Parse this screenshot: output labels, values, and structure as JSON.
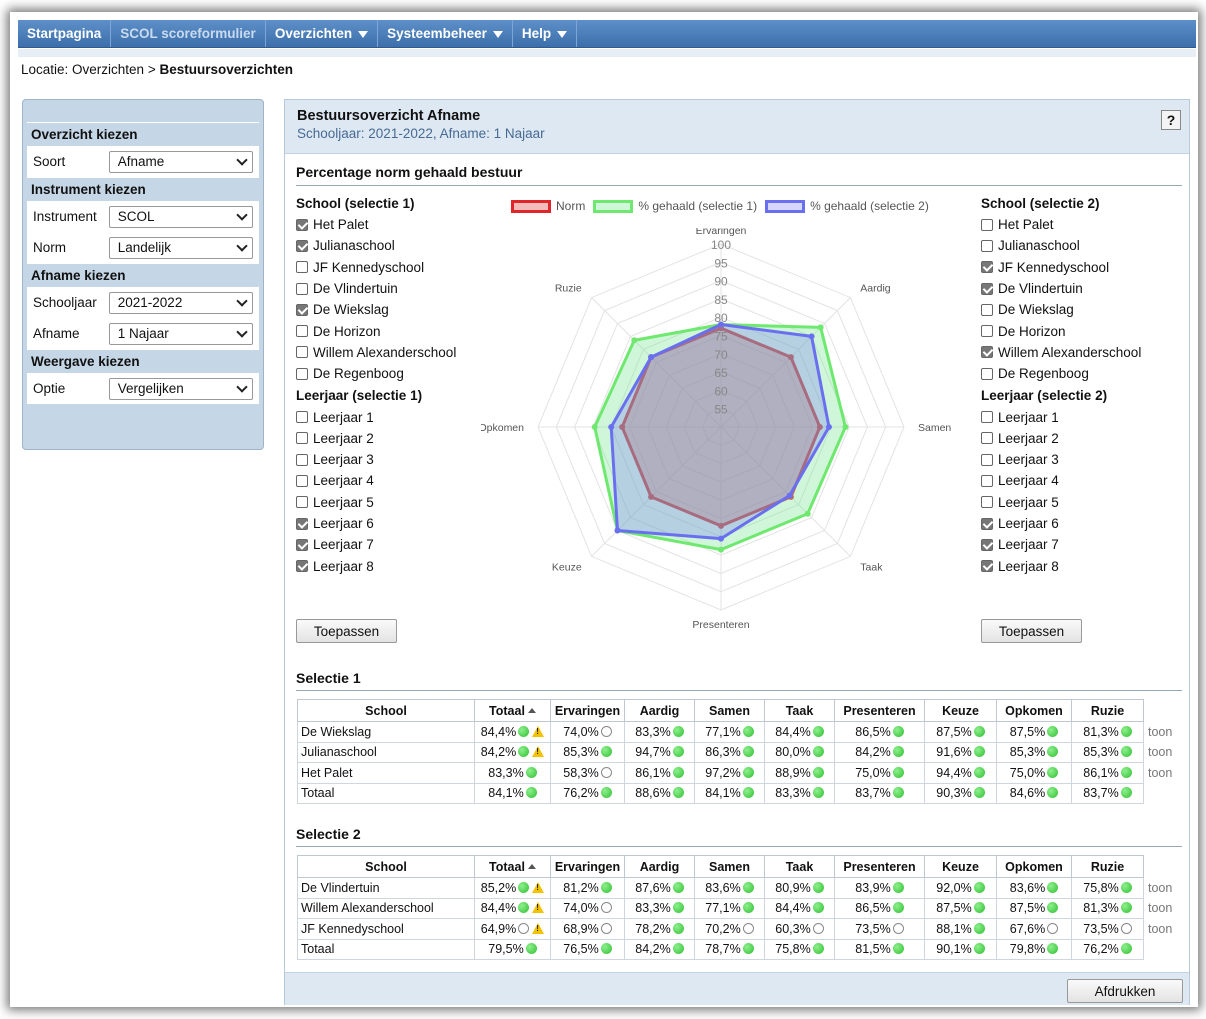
{
  "nav": {
    "items": [
      {
        "label": "Startpagina",
        "dropdown": false,
        "active": false
      },
      {
        "label": "SCOL scoreformulier",
        "dropdown": false,
        "active": true
      },
      {
        "label": "Overzichten",
        "dropdown": true,
        "active": false
      },
      {
        "label": "Systeembeheer",
        "dropdown": true,
        "active": false
      },
      {
        "label": "Help",
        "dropdown": true,
        "active": false
      }
    ]
  },
  "breadcrumb": {
    "prefix": "Locatie: Overzichten > ",
    "current": "Bestuursoverzichten"
  },
  "sidebar": {
    "sections": [
      {
        "title": "Overzicht kiezen",
        "rows": [
          {
            "label": "Soort",
            "value": "Afname"
          }
        ]
      },
      {
        "title": "Instrument kiezen",
        "rows": [
          {
            "label": "Instrument",
            "value": "SCOL"
          },
          {
            "label": "Norm",
            "value": "Landelijk"
          }
        ]
      },
      {
        "title": "Afname kiezen",
        "rows": [
          {
            "label": "Schooljaar",
            "value": "2021-2022"
          },
          {
            "label": "Afname",
            "value": "1 Najaar"
          }
        ]
      },
      {
        "title": "Weergave kiezen",
        "rows": [
          {
            "label": "Optie",
            "value": "Vergelijken"
          }
        ]
      }
    ]
  },
  "main": {
    "title": "Bestuursoverzicht Afname",
    "subtitle": "Schooljaar: 2021-2022, Afname: 1 Najaar",
    "help_label": "?",
    "section_title": "Percentage norm gehaald bestuur",
    "print_label": "Afdrukken"
  },
  "selection1": {
    "school_heading": "School (selectie 1)",
    "schools": [
      {
        "label": "Het Palet",
        "checked": true
      },
      {
        "label": "Julianaschool",
        "checked": true
      },
      {
        "label": "JF Kennedyschool",
        "checked": false
      },
      {
        "label": "De Vlindertuin",
        "checked": false
      },
      {
        "label": "De Wiekslag",
        "checked": true
      },
      {
        "label": "De Horizon",
        "checked": false
      },
      {
        "label": "Willem Alexanderschool",
        "checked": false
      },
      {
        "label": "De Regenboog",
        "checked": false
      }
    ],
    "year_heading": "Leerjaar (selectie 1)",
    "years": [
      {
        "label": "Leerjaar 1",
        "checked": false
      },
      {
        "label": "Leerjaar 2",
        "checked": false
      },
      {
        "label": "Leerjaar 3",
        "checked": false
      },
      {
        "label": "Leerjaar 4",
        "checked": false
      },
      {
        "label": "Leerjaar 5",
        "checked": false
      },
      {
        "label": "Leerjaar 6",
        "checked": true
      },
      {
        "label": "Leerjaar 7",
        "checked": true
      },
      {
        "label": "Leerjaar 8",
        "checked": true
      }
    ],
    "apply_label": "Toepassen"
  },
  "selection2": {
    "school_heading": "School (selectie 2)",
    "schools": [
      {
        "label": "Het Palet",
        "checked": false
      },
      {
        "label": "Julianaschool",
        "checked": false
      },
      {
        "label": "JF Kennedyschool",
        "checked": true
      },
      {
        "label": "De Vlindertuin",
        "checked": true
      },
      {
        "label": "De Wiekslag",
        "checked": false
      },
      {
        "label": "De Horizon",
        "checked": false
      },
      {
        "label": "Willem Alexanderschool",
        "checked": true
      },
      {
        "label": "De Regenboog",
        "checked": false
      }
    ],
    "year_heading": "Leerjaar (selectie 2)",
    "years": [
      {
        "label": "Leerjaar 1",
        "checked": false
      },
      {
        "label": "Leerjaar 2",
        "checked": false
      },
      {
        "label": "Leerjaar 3",
        "checked": false
      },
      {
        "label": "Leerjaar 4",
        "checked": false
      },
      {
        "label": "Leerjaar 5",
        "checked": false
      },
      {
        "label": "Leerjaar 6",
        "checked": true
      },
      {
        "label": "Leerjaar 7",
        "checked": true
      },
      {
        "label": "Leerjaar 8",
        "checked": true
      }
    ],
    "apply_label": "Toepassen"
  },
  "chart_data": {
    "type": "radar",
    "axes": [
      "Ervaringen",
      "Aardig",
      "Samen",
      "Taak",
      "Presenteren",
      "Keuze",
      "Opkomen",
      "Ruzie"
    ],
    "ticks": [
      55,
      60,
      65,
      70,
      75,
      80,
      85,
      90,
      95,
      100
    ],
    "range": [
      50,
      100
    ],
    "series": [
      {
        "name": "Norm",
        "color": "#e0262a",
        "fill": "rgba(224,60,60,0.35)",
        "values": [
          77,
          77,
          77,
          77,
          77,
          77,
          77,
          77
        ]
      },
      {
        "name": "% gehaald (selectie 1)",
        "color": "#6fe86f",
        "fill": "rgba(120,230,150,0.35)",
        "values": [
          78,
          88.5,
          84,
          83.5,
          83.5,
          90,
          84.5,
          83.5
        ]
      },
      {
        "name": "% gehaald (selectie 2)",
        "color": "#6a6ff0",
        "fill": "rgba(120,120,240,0.30)",
        "values": [
          78,
          85,
          79.5,
          76.5,
          80.5,
          90,
          80,
          77
        ]
      }
    ],
    "legend_position": "top"
  },
  "tables": {
    "columns": [
      "School",
      "Totaal",
      "Ervaringen",
      "Aardig",
      "Samen",
      "Taak",
      "Presenteren",
      "Keuze",
      "Opkomen",
      "Ruzie"
    ],
    "toon_label": "toon",
    "selectie1": {
      "title": "Selectie 1",
      "rows": [
        {
          "school": "De Wiekslag",
          "cells": [
            [
              "84,4%",
              "g",
              true
            ],
            [
              "74,0%",
              "w"
            ],
            [
              "83,3%",
              "g"
            ],
            [
              "77,1%",
              "g"
            ],
            [
              "84,4%",
              "g"
            ],
            [
              "86,5%",
              "g"
            ],
            [
              "87,5%",
              "g"
            ],
            [
              "87,5%",
              "g"
            ],
            [
              "81,3%",
              "g"
            ]
          ],
          "toon": true
        },
        {
          "school": "Julianaschool",
          "cells": [
            [
              "84,2%",
              "g",
              true
            ],
            [
              "85,3%",
              "g"
            ],
            [
              "94,7%",
              "g"
            ],
            [
              "86,3%",
              "g"
            ],
            [
              "80,0%",
              "g"
            ],
            [
              "84,2%",
              "g"
            ],
            [
              "91,6%",
              "g"
            ],
            [
              "85,3%",
              "g"
            ],
            [
              "85,3%",
              "g"
            ]
          ],
          "toon": true
        },
        {
          "school": "Het Palet",
          "cells": [
            [
              "83,3%",
              "g"
            ],
            [
              "58,3%",
              "w"
            ],
            [
              "86,1%",
              "g"
            ],
            [
              "97,2%",
              "g"
            ],
            [
              "88,9%",
              "g"
            ],
            [
              "75,0%",
              "g"
            ],
            [
              "94,4%",
              "g"
            ],
            [
              "75,0%",
              "g"
            ],
            [
              "86,1%",
              "g"
            ]
          ],
          "toon": true
        },
        {
          "school": "Totaal",
          "cells": [
            [
              "84,1%",
              "g"
            ],
            [
              "76,2%",
              "g"
            ],
            [
              "88,6%",
              "g"
            ],
            [
              "84,1%",
              "g"
            ],
            [
              "83,3%",
              "g"
            ],
            [
              "83,7%",
              "g"
            ],
            [
              "90,3%",
              "g"
            ],
            [
              "84,6%",
              "g"
            ],
            [
              "83,7%",
              "g"
            ]
          ],
          "toon": false
        }
      ]
    },
    "selectie2": {
      "title": "Selectie 2",
      "rows": [
        {
          "school": "De Vlindertuin",
          "cells": [
            [
              "85,2%",
              "g",
              true
            ],
            [
              "81,2%",
              "g"
            ],
            [
              "87,6%",
              "g"
            ],
            [
              "83,6%",
              "g"
            ],
            [
              "80,9%",
              "g"
            ],
            [
              "83,9%",
              "g"
            ],
            [
              "92,0%",
              "g"
            ],
            [
              "83,6%",
              "g"
            ],
            [
              "75,8%",
              "g"
            ]
          ],
          "toon": true
        },
        {
          "school": "Willem Alexanderschool",
          "cells": [
            [
              "84,4%",
              "g",
              true
            ],
            [
              "74,0%",
              "w"
            ],
            [
              "83,3%",
              "g"
            ],
            [
              "77,1%",
              "g"
            ],
            [
              "84,4%",
              "g"
            ],
            [
              "86,5%",
              "g"
            ],
            [
              "87,5%",
              "g"
            ],
            [
              "87,5%",
              "g"
            ],
            [
              "81,3%",
              "g"
            ]
          ],
          "toon": true
        },
        {
          "school": "JF Kennedyschool",
          "cells": [
            [
              "64,9%",
              "w",
              true
            ],
            [
              "68,9%",
              "w"
            ],
            [
              "78,2%",
              "g"
            ],
            [
              "70,2%",
              "w"
            ],
            [
              "60,3%",
              "w"
            ],
            [
              "73,5%",
              "w"
            ],
            [
              "88,1%",
              "g"
            ],
            [
              "67,6%",
              "w"
            ],
            [
              "73,5%",
              "w"
            ]
          ],
          "toon": true
        },
        {
          "school": "Totaal",
          "cells": [
            [
              "79,5%",
              "g"
            ],
            [
              "76,5%",
              "g"
            ],
            [
              "84,2%",
              "g"
            ],
            [
              "78,7%",
              "g"
            ],
            [
              "75,8%",
              "g"
            ],
            [
              "81,5%",
              "g"
            ],
            [
              "90,1%",
              "g"
            ],
            [
              "79,8%",
              "g"
            ],
            [
              "76,2%",
              "g"
            ]
          ],
          "toon": false
        }
      ]
    }
  }
}
